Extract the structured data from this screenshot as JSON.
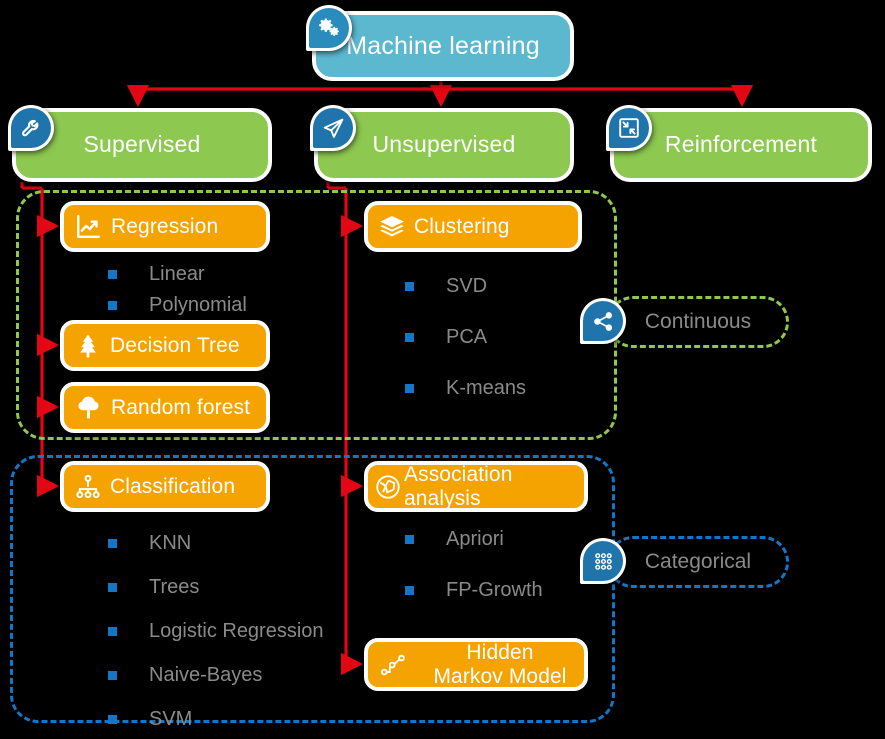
{
  "diagram": {
    "title": "Machine learning",
    "colors": {
      "root": "#5bb8cf",
      "branch": "#8dc850",
      "leaf": "#f5a300",
      "connector": "#e30613",
      "bullet": "#1476c6",
      "bullet_text": "#8a8a8a",
      "badge": "#1f74ab",
      "background": "#000000"
    }
  },
  "root": {
    "label": "Machine learning",
    "icon": "gears-icon"
  },
  "branches": [
    {
      "label": "Supervised",
      "icon": "wrench-icon"
    },
    {
      "label": "Unsupervised",
      "icon": "paper-plane-icon"
    },
    {
      "label": "Reinforcement",
      "icon": "compress-arrows-icon"
    }
  ],
  "supervised": {
    "regression": {
      "label": "Regression",
      "icon": "line-chart-icon",
      "items": [
        "Linear",
        "Polynomial"
      ]
    },
    "decision_tree": {
      "label": "Decision Tree",
      "icon": "pine-tree-icon"
    },
    "random_forest": {
      "label": "Random forest",
      "icon": "tree-icon"
    },
    "classification": {
      "label": "Classification",
      "icon": "sitemap-icon",
      "items": [
        "KNN",
        "Trees",
        "Logistic Regression",
        "Naive-Bayes",
        "SVM"
      ]
    }
  },
  "unsupervised": {
    "clustering": {
      "label": "Clustering",
      "icon": "layers-icon",
      "items": [
        "SVD",
        "PCA",
        "K-means"
      ]
    },
    "association": {
      "label": "Association analysis",
      "icon": "network-globe-icon",
      "items": [
        "Apriori",
        "FP-Growth"
      ]
    },
    "hmm": {
      "label_line1": "Hidden",
      "label_line2": "Markov Model",
      "icon": "node-path-icon"
    }
  },
  "groups": [
    {
      "label": "Continuous",
      "icon": "share-nodes-icon",
      "color": "#8dc850"
    },
    {
      "label": "Categorical",
      "icon": "dot-grid-icon",
      "color": "#1476c6"
    }
  ]
}
